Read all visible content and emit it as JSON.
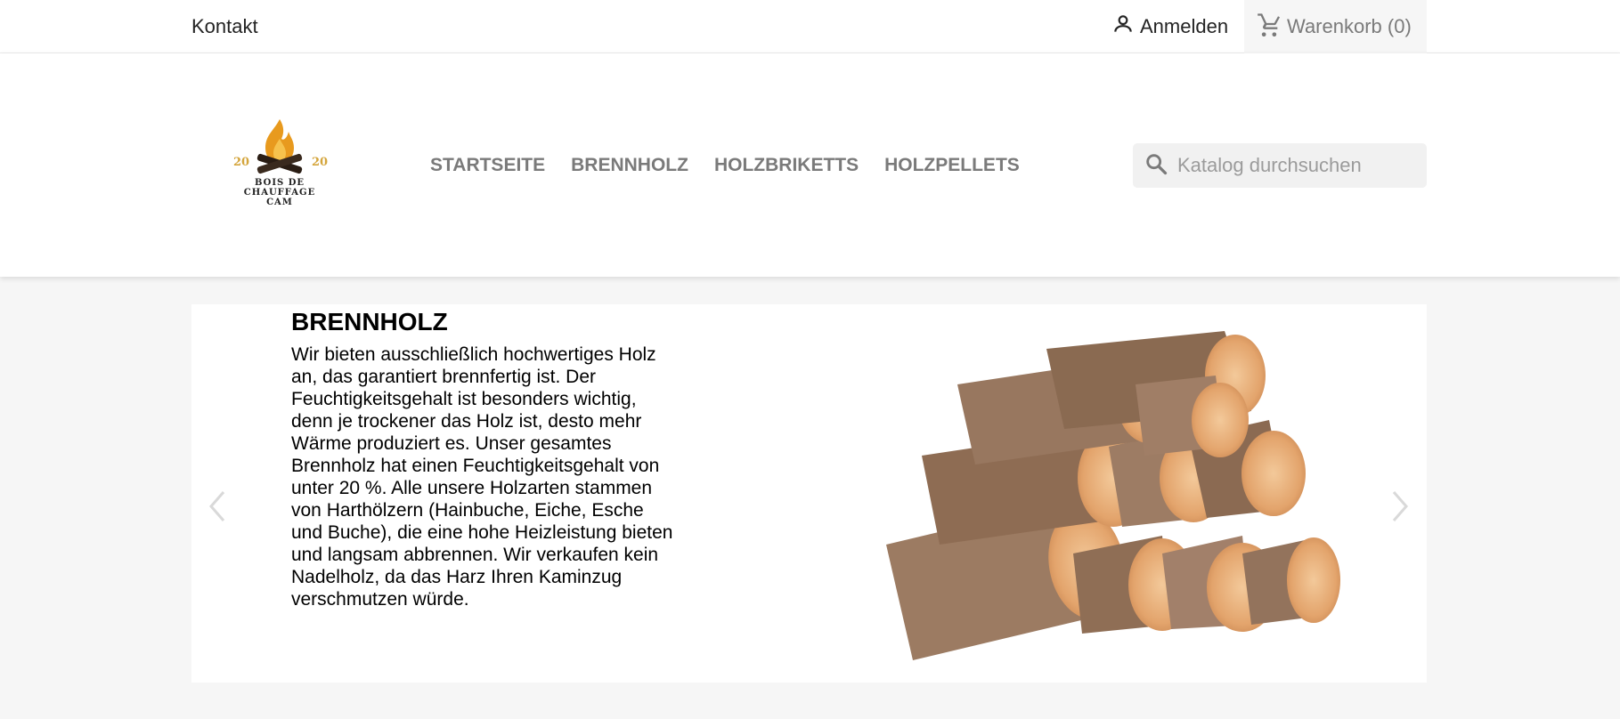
{
  "topbar": {
    "contact_label": "Kontakt",
    "signin_label": "Anmelden",
    "cart_label": "Warenkorb (0)"
  },
  "logo": {
    "year_left": "20",
    "year_right": "20",
    "line1": "BOIS DE CHAUFFAGE",
    "line2": "CAM"
  },
  "nav": {
    "items": [
      "STARTSEITE",
      "BRENNHOLZ",
      "HOLZBRIKETTS",
      "HOLZPELLETS"
    ]
  },
  "search": {
    "placeholder": "Katalog durchsuchen"
  },
  "slide": {
    "title": "BRENNHOLZ",
    "text": "Wir bieten ausschließlich hochwertiges Holz an, das garantiert brennfertig ist. Der Feuchtigkeitsgehalt ist besonders wichtig, denn je trockener das Holz ist, desto mehr Wärme produziert es. Unser gesamtes Brennholz hat einen Feuchtigkeitsgehalt von unter 20 %. Alle unsere Holzarten stammen von Harthölzern (Hainbuche, Eiche, Esche und Buche), die eine hohe Heizleistung bieten und langsam abbrennen. Wir verkaufen kein Nadelholz, da das Harz Ihren Kaminzug verschmutzen würde."
  },
  "icons": {
    "user": "user-icon",
    "cart": "cart-icon",
    "search": "search-icon",
    "prev": "chevron-left-icon",
    "next": "chevron-right-icon"
  },
  "colors": {
    "flame": "#e89a1e",
    "logo_gold": "#d4a53c",
    "nav_text": "#7a7a7a"
  }
}
